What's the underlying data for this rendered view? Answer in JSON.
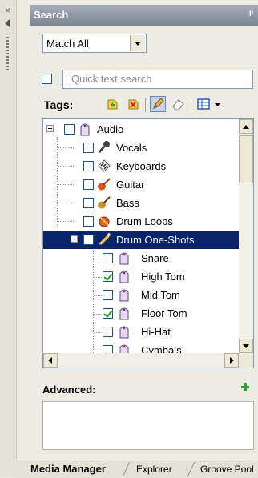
{
  "panel": {
    "title": "Search",
    "close_glyph": "×",
    "pin_glyph": "ᵖ"
  },
  "match_combo": {
    "value": "Match All"
  },
  "quick_search": {
    "placeholder": "Quick text search"
  },
  "tags_label": "Tags:",
  "toolbar_icons": [
    "add-tag-icon",
    "remove-tag-icon",
    "edit-tag-icon",
    "eraser-icon",
    "view-toggle-icon",
    "dropdown-arrow-icon"
  ],
  "tree": {
    "items": [
      {
        "label": "Audio",
        "checked": false,
        "icon": "tag-icon",
        "level": 0,
        "expanded": true
      },
      {
        "label": "Vocals",
        "checked": false,
        "icon": "microphone-icon",
        "level": 1
      },
      {
        "label": "Keyboards",
        "checked": false,
        "icon": "keyboard-icon",
        "level": 1
      },
      {
        "label": "Guitar",
        "checked": false,
        "icon": "guitar-icon",
        "level": 1
      },
      {
        "label": "Bass",
        "checked": false,
        "icon": "bass-icon",
        "level": 1
      },
      {
        "label": "Drum Loops",
        "checked": false,
        "icon": "drum-loops-icon",
        "level": 1
      },
      {
        "label": "Drum One-Shots",
        "checked": false,
        "icon": "drumsticks-icon",
        "level": 1,
        "expanded": true,
        "selected": true
      },
      {
        "label": "Snare",
        "checked": false,
        "icon": "tag-icon",
        "level": 2
      },
      {
        "label": "High Tom",
        "checked": true,
        "icon": "tag-icon",
        "level": 2
      },
      {
        "label": "Mid Tom",
        "checked": false,
        "icon": "tag-icon",
        "level": 2
      },
      {
        "label": "Floor Tom",
        "checked": true,
        "icon": "tag-icon",
        "level": 2
      },
      {
        "label": "Hi-Hat",
        "checked": false,
        "icon": "tag-icon",
        "level": 2
      },
      {
        "label": "Cymbals",
        "checked": false,
        "icon": "tag-icon",
        "level": 2
      }
    ]
  },
  "advanced": {
    "label": "Advanced:"
  },
  "tabs": [
    {
      "label": "Media Manager",
      "active": true
    },
    {
      "label": "Explorer",
      "active": false
    },
    {
      "label": "Groove Pool",
      "active": false
    }
  ],
  "colors": {
    "selection": "#0a246a",
    "title_bar": "#8a919d",
    "add_green": "#2aa62a",
    "tag_purple": "#c3a6d8"
  }
}
